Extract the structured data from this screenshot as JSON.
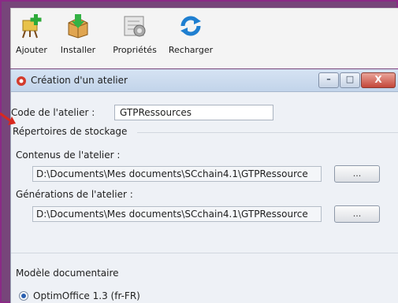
{
  "toolbar": {
    "buttons": [
      {
        "label": "Ajouter",
        "icon": "add-easel-icon"
      },
      {
        "label": "Installer",
        "icon": "install-box-icon"
      },
      {
        "label": "Propriétés",
        "icon": "properties-gear-icon"
      },
      {
        "label": "Recharger",
        "icon": "reload-icon"
      }
    ]
  },
  "dialog": {
    "title": "Création d'un atelier",
    "window_buttons": {
      "minimize": "–",
      "maximize": "□",
      "close": "X"
    },
    "code_label": "Code de l'atelier :",
    "code_value": "GTPRessources",
    "storage_group": "Répertoires de stockage",
    "contents_label": "Contenus de l'atelier :",
    "contents_path": "D:\\Documents\\Mes documents\\SCchain4.1\\GTPRessource",
    "generations_label": "Générations de l'atelier :",
    "generations_path": "D:\\Documents\\Mes documents\\SCchain4.1\\GTPRessource",
    "browse_label": "...",
    "model_group": "Modèle documentaire",
    "model_option": "OptimOffice 1.3 (fr-FR)"
  },
  "colors": {
    "accent_purple": "#77457a",
    "arrow_red": "#d9281e"
  }
}
